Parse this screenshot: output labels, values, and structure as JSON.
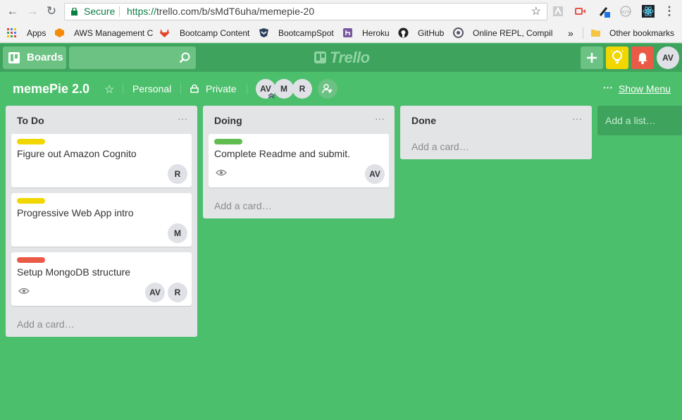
{
  "browser": {
    "secure_label": "Secure",
    "url_scheme": "https://",
    "url_rest": "trello.com/b/sMdT6uha/memepie-20",
    "bookmarks": [
      "Apps",
      "AWS Management C",
      "Bootcamp Content",
      "BootcampSpot",
      "Heroku",
      "GitHub",
      "Online REPL, Compil"
    ],
    "overflow": "»",
    "other_bookmarks": "Other bookmarks"
  },
  "header": {
    "boards_label": "Boards",
    "logo_text": "Trello",
    "user_initials": "AV",
    "colors": {
      "header_bg": "#3ea35d",
      "board_bg": "#4bbf6b",
      "tips_bg": "#f2d600",
      "notifications_bg": "#eb5a46"
    }
  },
  "board": {
    "title": "memePie 2.0",
    "team": "Personal",
    "visibility": "Private",
    "members": [
      "AV",
      "M",
      "R"
    ],
    "show_menu": "Show Menu",
    "menu_dots": "···",
    "add_list": "Add a list…"
  },
  "lists": [
    {
      "title": "To Do",
      "menu": "···",
      "add_card": "Add a card…",
      "cards": [
        {
          "label_color": "#f2d600",
          "title": "Figure out Amazon Cognito",
          "members": [
            "R"
          ],
          "watching": false
        },
        {
          "label_color": "#f2d600",
          "title": "Progressive Web App intro",
          "members": [
            "M"
          ],
          "watching": false
        },
        {
          "label_color": "#eb5a46",
          "title": "Setup MongoDB structure",
          "members": [
            "AV",
            "R"
          ],
          "watching": true
        }
      ]
    },
    {
      "title": "Doing",
      "menu": "···",
      "add_card": "Add a card…",
      "cards": [
        {
          "label_color": "#61bd4f",
          "title": "Complete Readme and submit.",
          "members": [
            "AV"
          ],
          "watching": true
        }
      ]
    },
    {
      "title": "Done",
      "menu": "···",
      "add_card": "Add a card…",
      "cards": []
    }
  ]
}
